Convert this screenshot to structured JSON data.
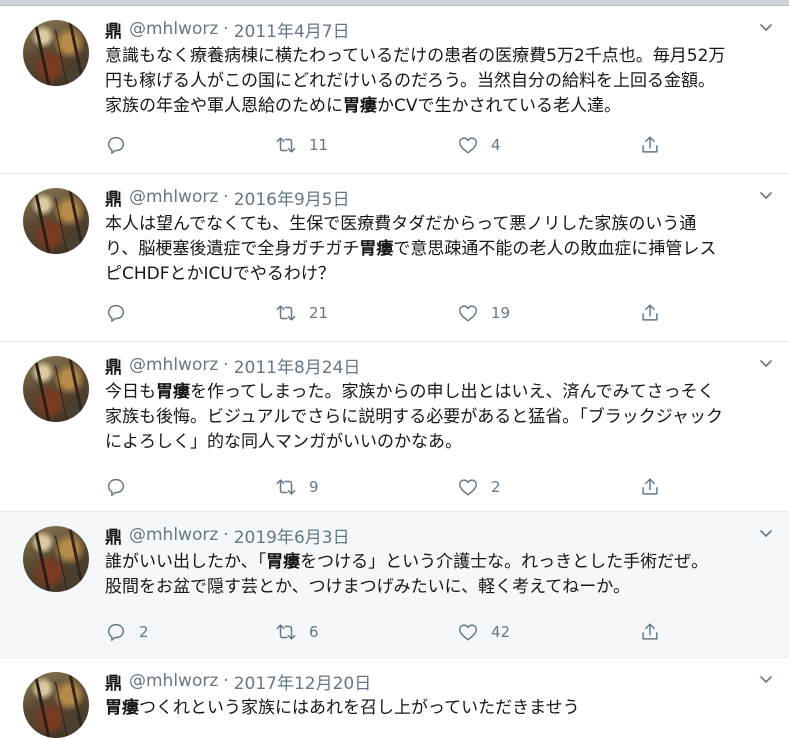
{
  "tweets": [
    {
      "name": "鼎",
      "handle": "@mhlworz",
      "separator": "·",
      "date": "2011年4月7日",
      "text": [
        {
          "t": "意識もなく療養病棟に横たわっているだけの患者の医療費5万2千点也。毎月52万\n円も稼げる人がこの国にどれだけいるのだろう。当然自分の給料を上回る金額。\n家族の年金や軍人恩給のために",
          "b": false
        },
        {
          "t": "胃瘻",
          "b": true
        },
        {
          "t": "かCVで生かされている老人達。",
          "b": false
        }
      ],
      "replies": "",
      "retweets": "11",
      "likes": "4"
    },
    {
      "name": "鼎",
      "handle": "@mhlworz",
      "separator": "·",
      "date": "2016年9月5日",
      "text": [
        {
          "t": "本人は望んでなくても、生保で医療費タダだからって悪ノリした家族のいう通\nり、脳梗塞後遺症で全身ガチガチ",
          "b": false
        },
        {
          "t": "胃瘻",
          "b": true
        },
        {
          "t": "で意思疎通不能の老人の敗血症に挿管レス\nピCHDFとかICUでやるわけ？",
          "b": false
        }
      ],
      "replies": "",
      "retweets": "21",
      "likes": "19"
    },
    {
      "name": "鼎",
      "handle": "@mhlworz",
      "separator": "·",
      "date": "2011年8月24日",
      "text": [
        {
          "t": "今日も",
          "b": false
        },
        {
          "t": "胃瘻",
          "b": true
        },
        {
          "t": "を作ってしまった。家族からの申し出とはいえ、済んでみてさっそく\n家族も後悔。ビジュアルでさらに説明する必要があると猛省。「ブラックジャック\nによろしく」的な同人マンガがいいのかなあ。",
          "b": false
        }
      ],
      "replies": "",
      "retweets": "9",
      "likes": "2"
    },
    {
      "name": "鼎",
      "handle": "@mhlworz",
      "separator": "·",
      "date": "2019年6月3日",
      "text": [
        {
          "t": "誰がいい出したか、「",
          "b": false
        },
        {
          "t": "胃瘻",
          "b": true
        },
        {
          "t": "をつける」という介護士な。れっきとした手術だぜ。\n股間をお盆で隠す芸とか、つけまつげみたいに、軽く考えてねーか。",
          "b": false
        }
      ],
      "replies": "2",
      "retweets": "6",
      "likes": "42"
    },
    {
      "name": "鼎",
      "handle": "@mhlworz",
      "separator": "·",
      "date": "2017年12月20日",
      "text": [
        {
          "t": "胃瘻",
          "b": true
        },
        {
          "t": "つくれという家族にはあれを召し上がっていただきませう",
          "b": false
        }
      ]
    }
  ],
  "colors": {
    "text": "#14171a",
    "muted": "#657786",
    "divider": "#e6ecf0",
    "hover_bg": "#f5f8fa"
  },
  "icons": {
    "reply": "reply-icon",
    "retweet": "retweet-icon",
    "like": "like-icon",
    "share": "share-icon",
    "menu": "chevron-down-icon"
  }
}
